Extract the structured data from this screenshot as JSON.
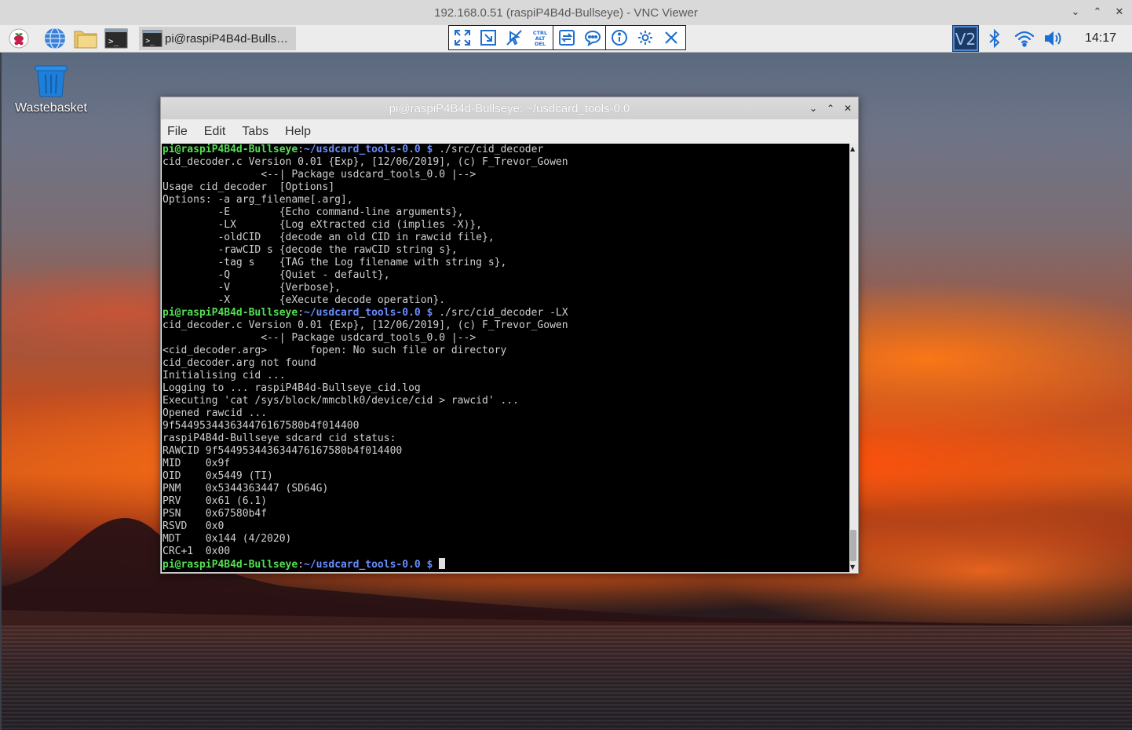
{
  "vnc": {
    "title": "192.168.0.51 (raspiP4B4d-Bullseye) - VNC Viewer"
  },
  "taskbar": {
    "task_label": "pi@raspiP4B4d-Bulls…",
    "clock": "14:17"
  },
  "desktop": {
    "icons": [
      {
        "label": "Wastebasket"
      }
    ]
  },
  "terminal": {
    "title": "pi@raspiP4B4d-Bullseye: ~/usdcard_tools-0.0",
    "menu": [
      "File",
      "Edit",
      "Tabs",
      "Help"
    ],
    "prompt_user": "pi@raspiP4B4d-Bullseye",
    "prompt_path": "~/usdcard_tools-0.0 $",
    "commands": [
      "./src/cid_decoder",
      "./src/cid_decoder -LX"
    ],
    "output1": [
      "cid_decoder.c Version 0.01 {Exp}, [12/06/2019], (c) F_Trevor_Gowen",
      "                <--| Package usdcard_tools_0.0 |-->",
      "Usage cid_decoder  [Options]",
      "Options: -a arg_filename[.arg],",
      "         -E        {Echo command-line arguments},",
      "         -LX       {Log eXtracted cid (implies -X)},",
      "         -oldCID   {decode an old CID in rawcid file},",
      "         -rawCID s {decode the rawCID string s},",
      "         -tag s    {TAG the Log filename with string s},",
      "         -Q        {Quiet - default},",
      "         -V        {Verbose},",
      "         -X        {eXecute decode operation}."
    ],
    "output2": [
      "cid_decoder.c Version 0.01 {Exp}, [12/06/2019], (c) F_Trevor_Gowen",
      "                <--| Package usdcard_tools_0.0 |-->",
      "<cid_decoder.arg>       fopen: No such file or directory",
      "cid_decoder.arg not found",
      "Initialising cid ...",
      "Logging to ... raspiP4B4d-Bullseye_cid.log",
      "Executing 'cat /sys/block/mmcblk0/device/cid > rawcid' ...",
      "Opened rawcid ...",
      "9f544953443634476167580b4f014400",
      "raspiP4B4d-Bullseye sdcard cid status:",
      "RAWCID 9f544953443634476167580b4f014400",
      "MID    0x9f",
      "OID    0x5449 (TI)",
      "PNM    0x5344363447 (SD64G)",
      "PRV    0x61 (6.1)",
      "PSN    0x67580b4f",
      "RSVD   0x0",
      "MDT    0x144 (4/2020)",
      "CRC+1  0x00"
    ]
  }
}
